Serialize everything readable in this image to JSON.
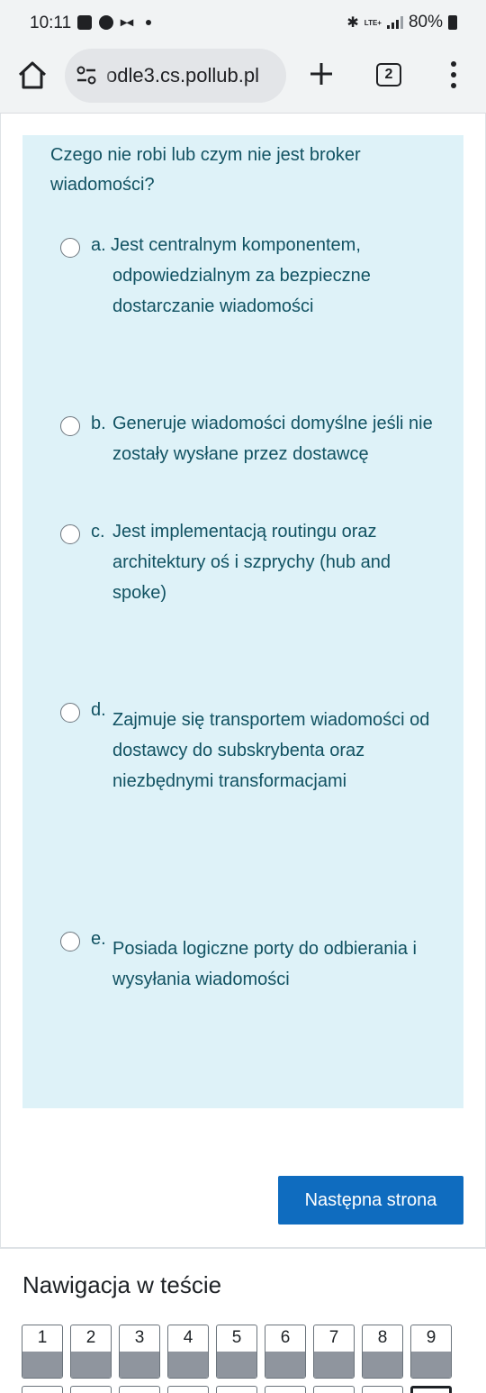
{
  "status_bar": {
    "time": "10:11",
    "network": "LTE+",
    "battery": "80%"
  },
  "browser": {
    "url": "odle3.cs.pollub.pl",
    "tab_count": "2"
  },
  "question": {
    "text": "Czego nie robi lub czym nie jest broker wiadomości?",
    "answers": [
      {
        "letter": "a.",
        "text": "Jest centralnym komponentem, odpowiedzialnym za bezpieczne dostarczanie wiadomości"
      },
      {
        "letter": "b.",
        "text": "Generuje wiadomości domyślne jeśli nie zostały wysłane przez dostawcę"
      },
      {
        "letter": "c.",
        "text": "Jest implementacją routingu oraz architektury oś i szprychy (hub and spoke)"
      },
      {
        "letter": "d.",
        "text": "Zajmuje się transportem wiadomości od dostawcy do subskrybenta oraz niezbędnymi transformacjami"
      },
      {
        "letter": "e.",
        "text": "Posiada logiczne porty do odbierania i wysyłania wiadomości"
      }
    ]
  },
  "next_button": "Następna strona",
  "navigation": {
    "title": "Nawigacja w teście",
    "items": [
      "1",
      "2",
      "3",
      "4",
      "5",
      "6",
      "7",
      "8",
      "9"
    ]
  }
}
